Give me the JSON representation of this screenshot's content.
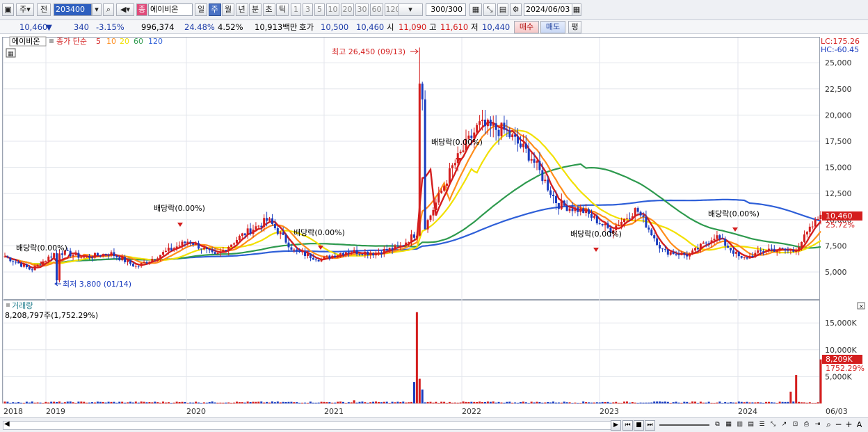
{
  "toolbar": {
    "type_label": "주",
    "prev_label": "전",
    "code": "203400",
    "name": "에이비온",
    "name_badge": "종",
    "periods": [
      {
        "label": "일",
        "selected": false
      },
      {
        "label": "주",
        "selected": true
      },
      {
        "label": "월",
        "selected": false
      },
      {
        "label": "년",
        "selected": false
      },
      {
        "label": "분",
        "selected": false
      },
      {
        "label": "초",
        "selected": false
      },
      {
        "label": "틱",
        "selected": false
      }
    ],
    "intervals": [
      "1",
      "3",
      "5",
      "10",
      "20",
      "30",
      "60",
      "120"
    ],
    "count": "300",
    "count_total": "/300",
    "date": "2024/06/03"
  },
  "quote": {
    "price": "10,460",
    "arrow": "▼",
    "change": "340",
    "change_pct": "-3.15%",
    "volume": "996,374",
    "turnover_pct": "24.48%",
    "pct2": "4.52%",
    "amount": "10,913백만",
    "bid_label": "호가",
    "bid1": "10,500",
    "bid2": "10,460",
    "open_label": "시",
    "open": "11,090",
    "high_label": "고",
    "high": "11,610",
    "low_label": "저",
    "low": "10,440",
    "buy": "매수",
    "sell": "매도",
    "avg": "평"
  },
  "chart": {
    "legend_name": "에이비온",
    "legend_ma": "종가 단순",
    "ma_periods": [
      "5",
      "10",
      "20",
      "60",
      "120"
    ],
    "ma_colors": [
      "#d41e1e",
      "#ff8c1a",
      "#f2e000",
      "#2e9a4e",
      "#2e5fd8"
    ],
    "lc": "LC:175.26",
    "hc": "HC:-60.45",
    "price_ticks": [
      "25,000",
      "22,500",
      "20,000",
      "17,500",
      "15,000",
      "12,500",
      "10,000",
      "7,500",
      "5,000"
    ],
    "last_price": "10,460",
    "last_pct": "25.72%",
    "high_note": "최고 26,450 (09/13)",
    "low_note": "최저 3,800 (01/14)",
    "dividends": [
      "배당락(0.00%)",
      "배당락(0.00%)",
      "배당락(0.00%)",
      "배당락(0.00%)",
      "배당락(0.00%)",
      "배당락(0.00%)"
    ],
    "volume_title": "거래량",
    "volume_info": "8,208,797주(1,752.29%)",
    "volume_ticks": [
      "15,000K",
      "10,000K",
      "5,000K"
    ],
    "last_volume": "8,209K",
    "last_volume_pct": "1752.29%",
    "x_labels": [
      "2018",
      "2019",
      "2020",
      "2021",
      "2022",
      "2023",
      "2024",
      "06/03"
    ]
  },
  "chart_data": {
    "type": "candlestick",
    "x": [
      "2018",
      "2019",
      "2020",
      "2021",
      "2022",
      "2023",
      "2024"
    ],
    "close_approx": [
      6500,
      5200,
      7000,
      6400,
      6800,
      5500,
      6800,
      8000,
      6500,
      8500,
      10000,
      7000,
      6200,
      7000,
      6800,
      7400,
      9500,
      15000,
      19000,
      18500,
      16000,
      11500,
      10800,
      9000,
      11000,
      7000,
      6600,
      8500,
      6200,
      7200,
      7000,
      10460
    ],
    "ylim": [
      3000,
      27000
    ],
    "high": {
      "value": 26450,
      "date": "09/13"
    },
    "low": {
      "value": 3800,
      "date": "01/14"
    },
    "last": 10460,
    "volume_last": 8208797,
    "volume_ylim": [
      0,
      17000000
    ]
  }
}
